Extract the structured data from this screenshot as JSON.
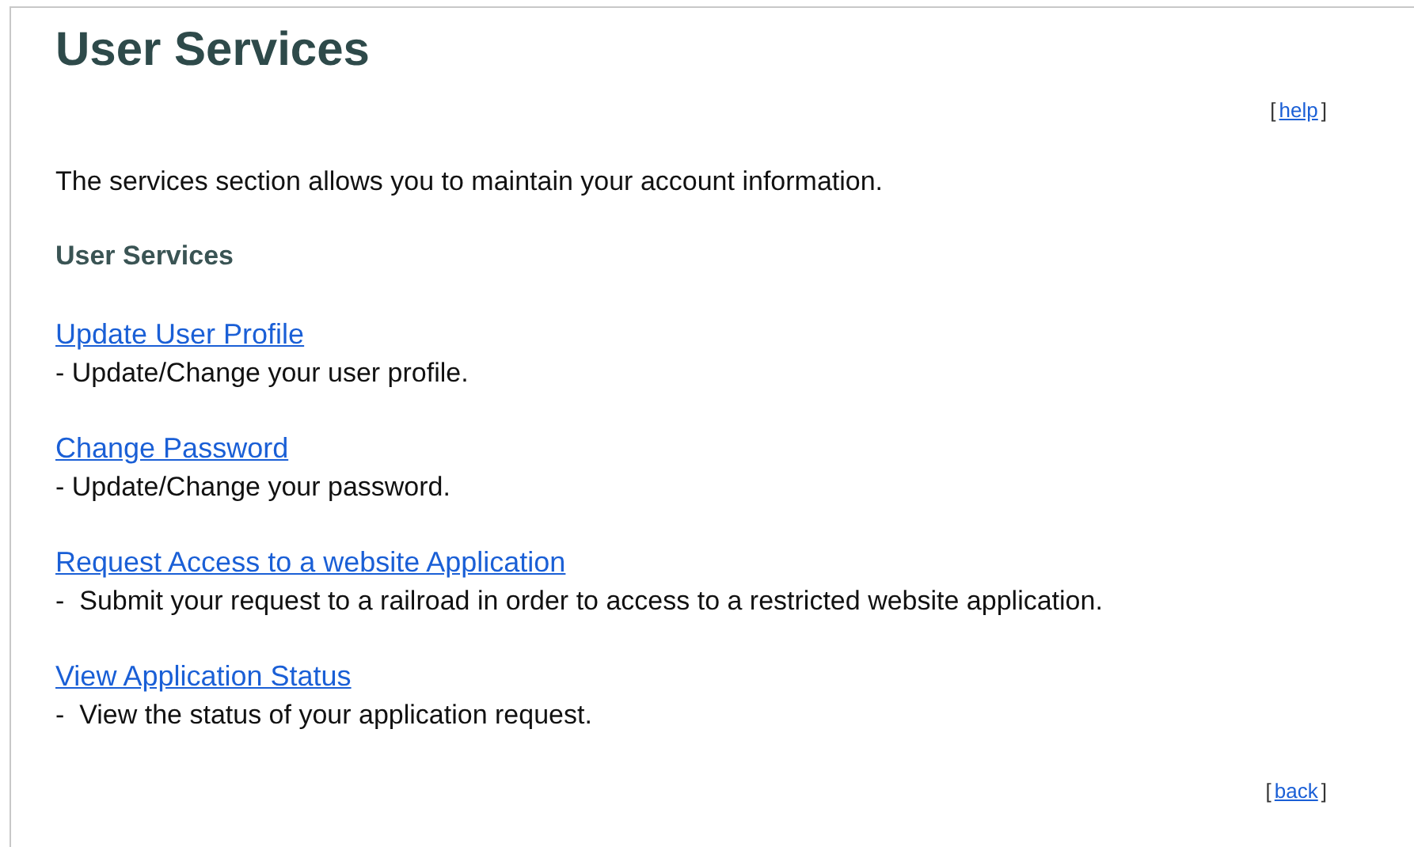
{
  "title": "User Services",
  "help_link": {
    "open": "[",
    "label": "help",
    "close": "]"
  },
  "intro": "The services section allows you to maintain your account information.",
  "section_heading": "User Services",
  "services": [
    {
      "link": "Update User Profile",
      "description": "- Update/Change your user profile."
    },
    {
      "link": "Change Password",
      "description": "- Update/Change your password."
    },
    {
      "link": "Request Access to a website Application",
      "description": "-  Submit your request to a railroad in order to access to a restricted website application."
    },
    {
      "link": "View Application Status",
      "description": "-  View the status of your application request."
    }
  ],
  "back_link": {
    "open": "[",
    "label": "back",
    "close": "]"
  }
}
